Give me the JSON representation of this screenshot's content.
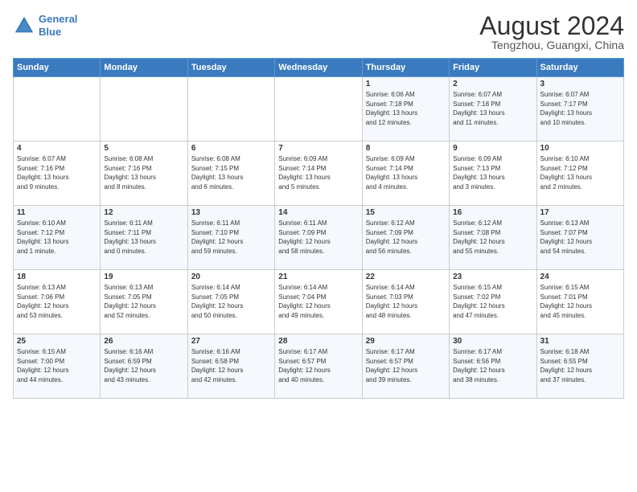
{
  "logo": {
    "line1": "General",
    "line2": "Blue"
  },
  "title": "August 2024",
  "location": "Tengzhou, Guangxi, China",
  "days_of_week": [
    "Sunday",
    "Monday",
    "Tuesday",
    "Wednesday",
    "Thursday",
    "Friday",
    "Saturday"
  ],
  "weeks": [
    [
      {
        "day": "",
        "info": ""
      },
      {
        "day": "",
        "info": ""
      },
      {
        "day": "",
        "info": ""
      },
      {
        "day": "",
        "info": ""
      },
      {
        "day": "1",
        "info": "Sunrise: 6:06 AM\nSunset: 7:18 PM\nDaylight: 13 hours\nand 12 minutes."
      },
      {
        "day": "2",
        "info": "Sunrise: 6:07 AM\nSunset: 7:18 PM\nDaylight: 13 hours\nand 11 minutes."
      },
      {
        "day": "3",
        "info": "Sunrise: 6:07 AM\nSunset: 7:17 PM\nDaylight: 13 hours\nand 10 minutes."
      }
    ],
    [
      {
        "day": "4",
        "info": "Sunrise: 6:07 AM\nSunset: 7:16 PM\nDaylight: 13 hours\nand 9 minutes."
      },
      {
        "day": "5",
        "info": "Sunrise: 6:08 AM\nSunset: 7:16 PM\nDaylight: 13 hours\nand 8 minutes."
      },
      {
        "day": "6",
        "info": "Sunrise: 6:08 AM\nSunset: 7:15 PM\nDaylight: 13 hours\nand 6 minutes."
      },
      {
        "day": "7",
        "info": "Sunrise: 6:09 AM\nSunset: 7:14 PM\nDaylight: 13 hours\nand 5 minutes."
      },
      {
        "day": "8",
        "info": "Sunrise: 6:09 AM\nSunset: 7:14 PM\nDaylight: 13 hours\nand 4 minutes."
      },
      {
        "day": "9",
        "info": "Sunrise: 6:09 AM\nSunset: 7:13 PM\nDaylight: 13 hours\nand 3 minutes."
      },
      {
        "day": "10",
        "info": "Sunrise: 6:10 AM\nSunset: 7:12 PM\nDaylight: 13 hours\nand 2 minutes."
      }
    ],
    [
      {
        "day": "11",
        "info": "Sunrise: 6:10 AM\nSunset: 7:12 PM\nDaylight: 13 hours\nand 1 minute."
      },
      {
        "day": "12",
        "info": "Sunrise: 6:11 AM\nSunset: 7:11 PM\nDaylight: 13 hours\nand 0 minutes."
      },
      {
        "day": "13",
        "info": "Sunrise: 6:11 AM\nSunset: 7:10 PM\nDaylight: 12 hours\nand 59 minutes."
      },
      {
        "day": "14",
        "info": "Sunrise: 6:11 AM\nSunset: 7:09 PM\nDaylight: 12 hours\nand 58 minutes."
      },
      {
        "day": "15",
        "info": "Sunrise: 6:12 AM\nSunset: 7:09 PM\nDaylight: 12 hours\nand 56 minutes."
      },
      {
        "day": "16",
        "info": "Sunrise: 6:12 AM\nSunset: 7:08 PM\nDaylight: 12 hours\nand 55 minutes."
      },
      {
        "day": "17",
        "info": "Sunrise: 6:13 AM\nSunset: 7:07 PM\nDaylight: 12 hours\nand 54 minutes."
      }
    ],
    [
      {
        "day": "18",
        "info": "Sunrise: 6:13 AM\nSunset: 7:06 PM\nDaylight: 12 hours\nand 53 minutes."
      },
      {
        "day": "19",
        "info": "Sunrise: 6:13 AM\nSunset: 7:05 PM\nDaylight: 12 hours\nand 52 minutes."
      },
      {
        "day": "20",
        "info": "Sunrise: 6:14 AM\nSunset: 7:05 PM\nDaylight: 12 hours\nand 50 minutes."
      },
      {
        "day": "21",
        "info": "Sunrise: 6:14 AM\nSunset: 7:04 PM\nDaylight: 12 hours\nand 49 minutes."
      },
      {
        "day": "22",
        "info": "Sunrise: 6:14 AM\nSunset: 7:03 PM\nDaylight: 12 hours\nand 48 minutes."
      },
      {
        "day": "23",
        "info": "Sunrise: 6:15 AM\nSunset: 7:02 PM\nDaylight: 12 hours\nand 47 minutes."
      },
      {
        "day": "24",
        "info": "Sunrise: 6:15 AM\nSunset: 7:01 PM\nDaylight: 12 hours\nand 45 minutes."
      }
    ],
    [
      {
        "day": "25",
        "info": "Sunrise: 6:15 AM\nSunset: 7:00 PM\nDaylight: 12 hours\nand 44 minutes."
      },
      {
        "day": "26",
        "info": "Sunrise: 6:16 AM\nSunset: 6:59 PM\nDaylight: 12 hours\nand 43 minutes."
      },
      {
        "day": "27",
        "info": "Sunrise: 6:16 AM\nSunset: 6:58 PM\nDaylight: 12 hours\nand 42 minutes."
      },
      {
        "day": "28",
        "info": "Sunrise: 6:17 AM\nSunset: 6:57 PM\nDaylight: 12 hours\nand 40 minutes."
      },
      {
        "day": "29",
        "info": "Sunrise: 6:17 AM\nSunset: 6:57 PM\nDaylight: 12 hours\nand 39 minutes."
      },
      {
        "day": "30",
        "info": "Sunrise: 6:17 AM\nSunset: 6:56 PM\nDaylight: 12 hours\nand 38 minutes."
      },
      {
        "day": "31",
        "info": "Sunrise: 6:18 AM\nSunset: 6:55 PM\nDaylight: 12 hours\nand 37 minutes."
      }
    ]
  ]
}
